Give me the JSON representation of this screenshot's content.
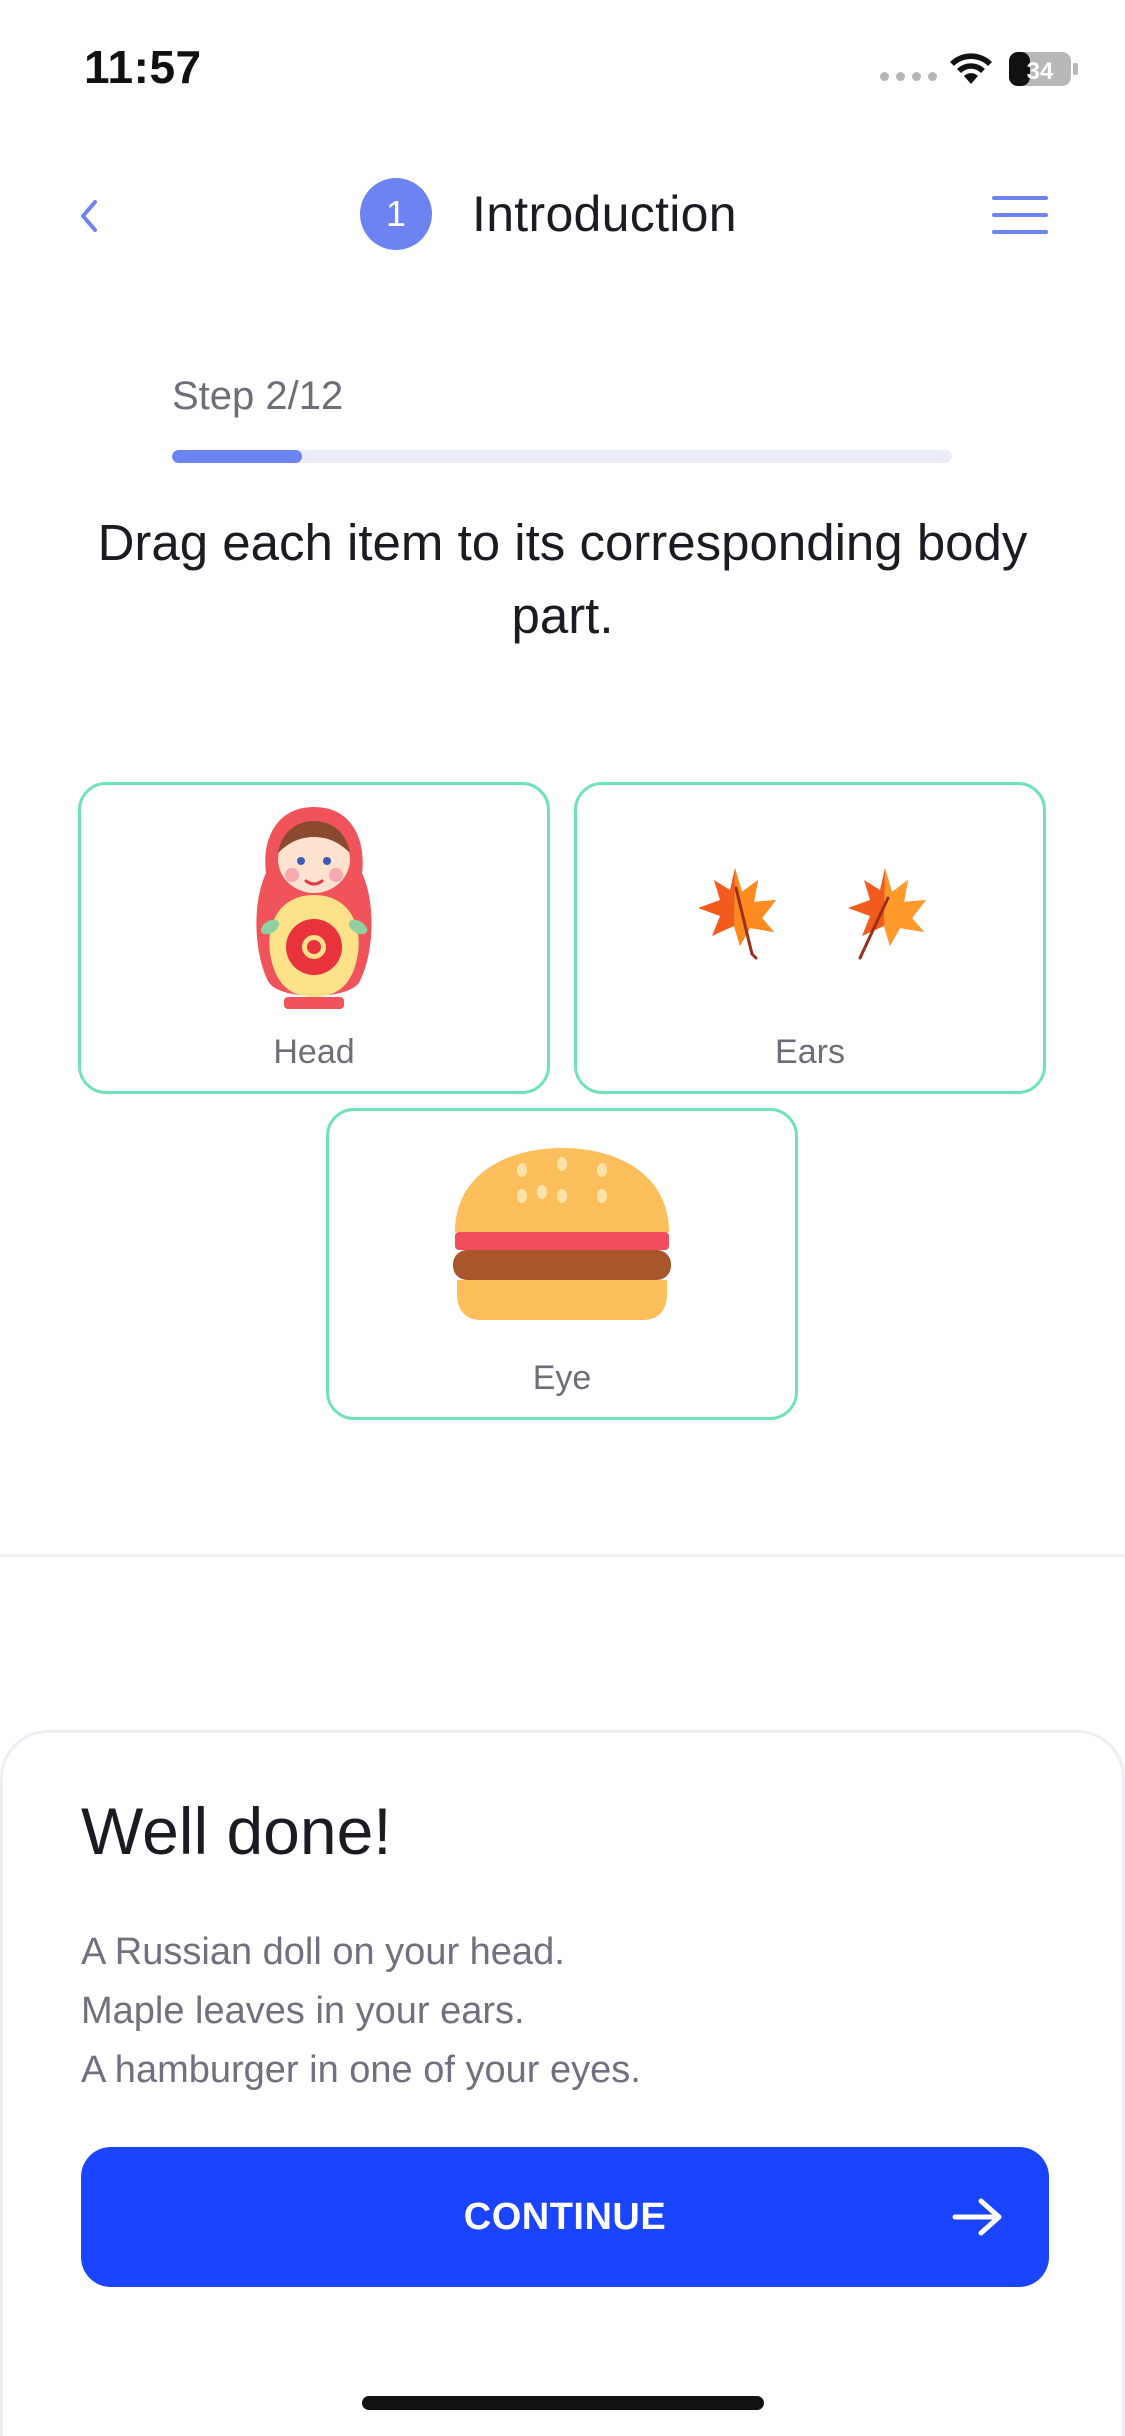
{
  "status_bar": {
    "time": "11:57",
    "battery": "34"
  },
  "header": {
    "step_number": "1",
    "title": "Introduction"
  },
  "progress": {
    "label": "Step 2/12",
    "value": 0.167
  },
  "instruction": "Drag each item to its corresponding body part.",
  "cards": [
    {
      "label": "Head",
      "icon": "matryoshka-doll-icon"
    },
    {
      "label": "Ears",
      "icon": "maple-leaves-icon"
    },
    {
      "label": "Eye",
      "icon": "hamburger-icon"
    }
  ],
  "feedback": {
    "title": "Well done!",
    "lines": [
      "A Russian doll on your head.",
      "Maple leaves in your ears.",
      "A hamburger in one of your eyes."
    ]
  },
  "continue_button": {
    "label": "CONTINUE"
  },
  "colors": {
    "accent": "#6d83f2",
    "primary_button": "#1a44ff",
    "card_border": "#6ee2b8"
  }
}
